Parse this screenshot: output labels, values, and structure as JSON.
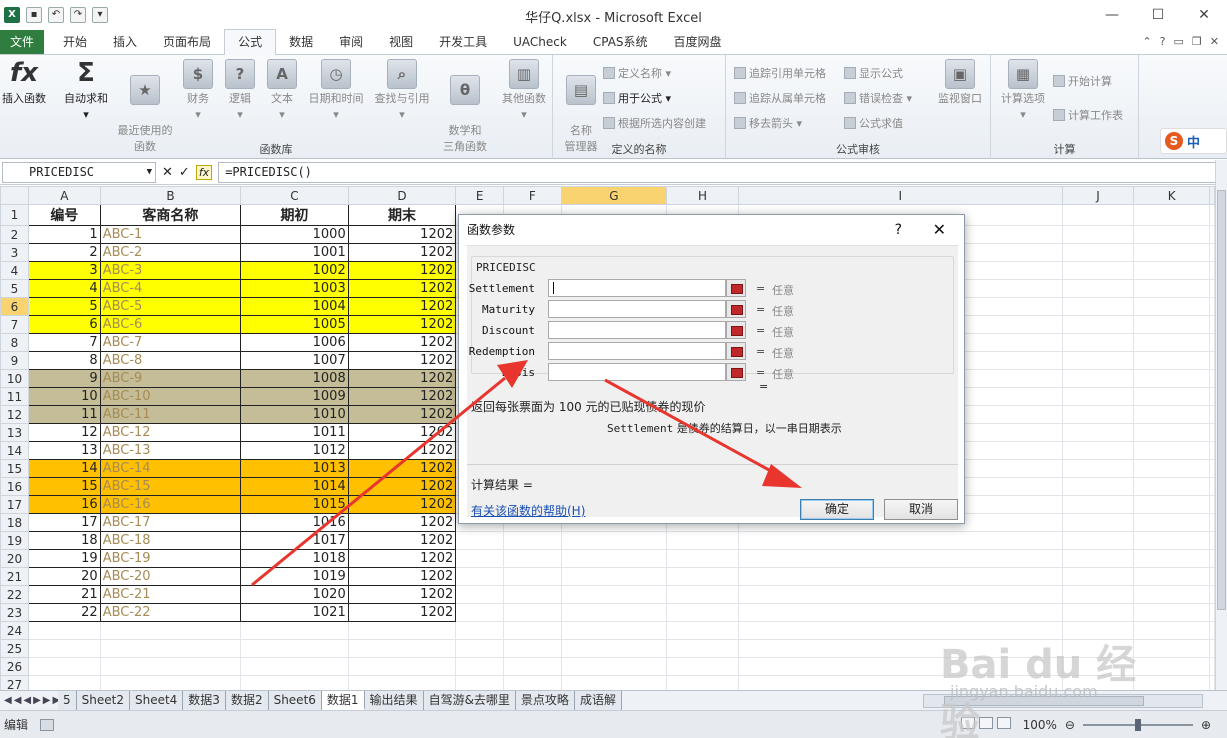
{
  "window": {
    "title": "华仔Q.xlsx - Microsoft Excel",
    "controls": [
      "—",
      "☐",
      "✕"
    ]
  },
  "tabs": [
    "文件",
    "开始",
    "插入",
    "页面布局",
    "公式",
    "数据",
    "审阅",
    "视图",
    "开发工具",
    "UACheck",
    "CPAS系统",
    "百度网盘"
  ],
  "active_tab": "公式",
  "ribbon": {
    "function_library": {
      "label": "函数库",
      "buttons": [
        "插入函数",
        "自动求和",
        "最近使用的\n函数",
        "财务",
        "逻辑",
        "文本",
        "日期和时间",
        "查找与引用",
        "数学和\n三角函数",
        "其他函数"
      ]
    },
    "defined_names": {
      "label": "定义的名称",
      "big": "名称\n管理器",
      "items": [
        "定义名称",
        "用于公式",
        "根据所选内容创建"
      ]
    },
    "formula_auditing": {
      "label": "公式审核",
      "items": [
        "追踪引用单元格",
        "追踪从属单元格",
        "移去箭头",
        "显示公式",
        "错误检查",
        "公式求值"
      ],
      "big": "监视窗口"
    },
    "calculation": {
      "label": "计算",
      "big": "计算选项",
      "items": [
        "开始计算",
        "计算工作表"
      ]
    }
  },
  "ime": {
    "logo": "S",
    "mode": "中"
  },
  "formula_bar": {
    "name_box": "PRICEDISC",
    "formula": "=PRICEDISC()",
    "cancel": "✕",
    "enter": "✓",
    "fx": "fx"
  },
  "sheet": {
    "columns": [
      "A",
      "B",
      "C",
      "D",
      "E",
      "F",
      "G",
      "H",
      "I",
      "J",
      "K"
    ],
    "headers": [
      "编号",
      "客商名称",
      "期初",
      "期末"
    ],
    "rows": [
      {
        "id": 1,
        "name": "ABC-1",
        "start": 1000,
        "end": 1202,
        "fill": ""
      },
      {
        "id": 2,
        "name": "ABC-2",
        "start": 1001,
        "end": 1202,
        "fill": ""
      },
      {
        "id": 3,
        "name": "ABC-3",
        "start": 1002,
        "end": 1202,
        "fill": "yellow"
      },
      {
        "id": 4,
        "name": "ABC-4",
        "start": 1003,
        "end": 1202,
        "fill": "yellow"
      },
      {
        "id": 5,
        "name": "ABC-5",
        "start": 1004,
        "end": 1202,
        "fill": "yellow"
      },
      {
        "id": 6,
        "name": "ABC-6",
        "start": 1005,
        "end": 1202,
        "fill": "yellow"
      },
      {
        "id": 7,
        "name": "ABC-7",
        "start": 1006,
        "end": 1202,
        "fill": ""
      },
      {
        "id": 8,
        "name": "ABC-8",
        "start": 1007,
        "end": 1202,
        "fill": ""
      },
      {
        "id": 9,
        "name": "ABC-9",
        "start": 1008,
        "end": 1202,
        "fill": "khaki"
      },
      {
        "id": 10,
        "name": "ABC-10",
        "start": 1009,
        "end": 1202,
        "fill": "khaki"
      },
      {
        "id": 11,
        "name": "ABC-11",
        "start": 1010,
        "end": 1202,
        "fill": "khaki"
      },
      {
        "id": 12,
        "name": "ABC-12",
        "start": 1011,
        "end": 1202,
        "fill": ""
      },
      {
        "id": 13,
        "name": "ABC-13",
        "start": 1012,
        "end": 1202,
        "fill": ""
      },
      {
        "id": 14,
        "name": "ABC-14",
        "start": 1013,
        "end": 1202,
        "fill": "orange"
      },
      {
        "id": 15,
        "name": "ABC-15",
        "start": 1014,
        "end": 1202,
        "fill": "orange"
      },
      {
        "id": 16,
        "name": "ABC-16",
        "start": 1015,
        "end": 1202,
        "fill": "orange"
      },
      {
        "id": 17,
        "name": "ABC-17",
        "start": 1016,
        "end": 1202,
        "fill": ""
      },
      {
        "id": 18,
        "name": "ABC-18",
        "start": 1017,
        "end": 1202,
        "fill": ""
      },
      {
        "id": 19,
        "name": "ABC-19",
        "start": 1018,
        "end": 1202,
        "fill": ""
      },
      {
        "id": 20,
        "name": "ABC-20",
        "start": 1019,
        "end": 1202,
        "fill": ""
      },
      {
        "id": 21,
        "name": "ABC-21",
        "start": 1020,
        "end": 1202,
        "fill": ""
      },
      {
        "id": 22,
        "name": "ABC-22",
        "start": 1021,
        "end": 1202,
        "fill": ""
      }
    ],
    "extra_row_numbers": [
      24,
      25,
      26,
      27
    ],
    "selected_column": "G",
    "selected_row": 6
  },
  "sheet_tabs": {
    "tabs": [
      "5",
      "Sheet2",
      "Sheet4",
      "数据3",
      "数据2",
      "Sheet6",
      "数据1",
      "输出结果",
      "自驾游&去哪里",
      "景点攻略",
      "成语解"
    ],
    "active": "数据1"
  },
  "status_bar": {
    "mode": "编辑",
    "zoom": "100%"
  },
  "dialog": {
    "title": "函数参数",
    "help_glyph": "?",
    "close_glyph": "✕",
    "function_name": "PRICEDISC",
    "args": [
      {
        "label": "Settlement",
        "hint": "任意"
      },
      {
        "label": "Maturity",
        "hint": "任意"
      },
      {
        "label": "Discount",
        "hint": "任意"
      },
      {
        "label": "Redemption",
        "hint": "任意"
      },
      {
        "label": "Basis",
        "hint": "任意"
      }
    ],
    "eq": "=",
    "description": "返回每张票面为 100 元的已贴现债券的现价",
    "arg_key": "Settlement",
    "arg_description": "是债券的结算日，以一串日期表示",
    "result_label": "计算结果 =",
    "help_link": "有关该函数的帮助(H)",
    "ok": "确定",
    "cancel": "取消"
  },
  "colors": {
    "accent_red": "#e8352d",
    "yellow": "#ffff00",
    "khaki": "#c4bd97",
    "orange": "#ffc000",
    "file_tab": "#2f7d3f"
  },
  "watermark": {
    "brand": "Bai du 经验",
    "url": "jingyan.baidu.com"
  }
}
